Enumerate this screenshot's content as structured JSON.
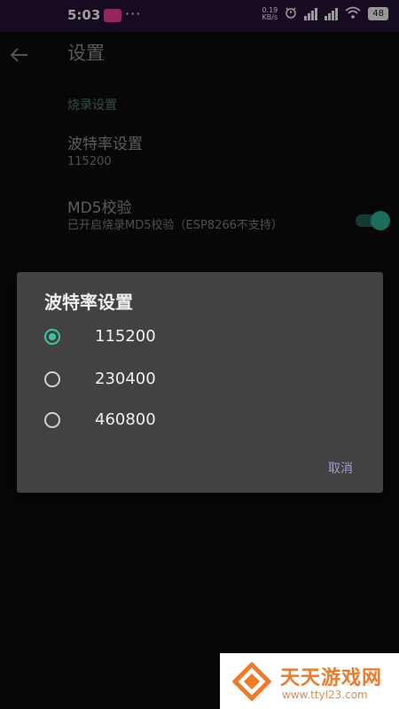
{
  "statusbar": {
    "time": "5:03",
    "dots": "···",
    "netspeed_value": "0.19",
    "netspeed_unit": "KB/s",
    "battery": "48",
    "icons": [
      "app-notification-icon",
      "alarm-icon",
      "hd-signal-icon",
      "signal-icon",
      "wifi-icon",
      "battery-icon"
    ]
  },
  "appbar": {
    "back_icon": "arrow-left-icon",
    "title": "设置"
  },
  "settings": {
    "section_header": "烧录设置",
    "baud_title": "波特率设置",
    "baud_value": "115200",
    "md5_title": "MD5校验",
    "md5_summary": "已开启烧录MD5校验（ESP8266不支持）",
    "md5_enabled": true
  },
  "dialog": {
    "title": "波特率设置",
    "options": [
      {
        "label": "115200",
        "checked": true
      },
      {
        "label": "230400",
        "checked": false
      },
      {
        "label": "460800",
        "checked": false
      }
    ],
    "cancel_label": "取消",
    "accent_color": "#3dc4a6"
  },
  "watermark": {
    "name": "天天游戏网",
    "url": "www.ttyl23.com"
  }
}
